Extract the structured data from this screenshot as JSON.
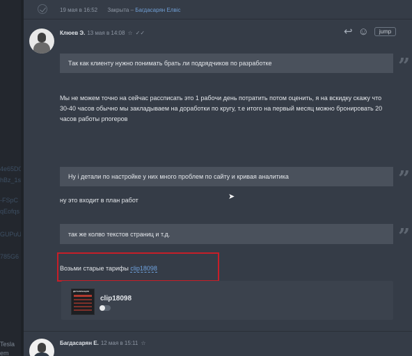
{
  "left_fragments": [
    "4e65D0",
    "hBz_1s",
    "-FSpC",
    "qEofqs",
    "GUPuU",
    "785G6",
    "Tesla",
    "em"
  ],
  "top_item": {
    "date": "19 мая в 16:52",
    "status": "Закрыта –",
    "assignee": "Багдасарян Елвіс"
  },
  "message": {
    "author": "Клюев Э.",
    "date": "13 мая в 14:08",
    "star_icon": "☆",
    "check_icon": "✓✓",
    "actions": {
      "reply_icon": "↩",
      "emoji_icon": "☺",
      "jump_label": "jump"
    },
    "quote1": "Так как клиенту нужно понимать брать ли подрядчиков по разработке",
    "paragraph1": "Мы не можем точно на сейчас рассписать это 1 рабочи день потратить потом оценить, я на вскидку скажу что 30-40 часов обычно мы закладываем на доработки по кругу, т.е итого на первый месяц можно бронировать 20 часов работы рпогеров",
    "quote2": "Ну і детали по настройке у них много проблем по сайту и кривая аналитика",
    "paragraph2": "ну это входит в план работ",
    "quote3": "так же колво текстов страниц и т.д.",
    "paragraph3_text": "Возьми старые тарифы ",
    "paragraph3_link": "clip18098",
    "preview": {
      "title": "clip18098",
      "thumb_label": "ДЕТАЛИЗАЦИЯ"
    }
  },
  "next_message": {
    "author": "Багдасарян Е.",
    "date": "12 мая в 15:11",
    "star_icon": "☆"
  },
  "colors": {
    "accent_link": "#6fa3e0",
    "highlight_box": "#c81e28",
    "panel_bg": "#353c47"
  }
}
